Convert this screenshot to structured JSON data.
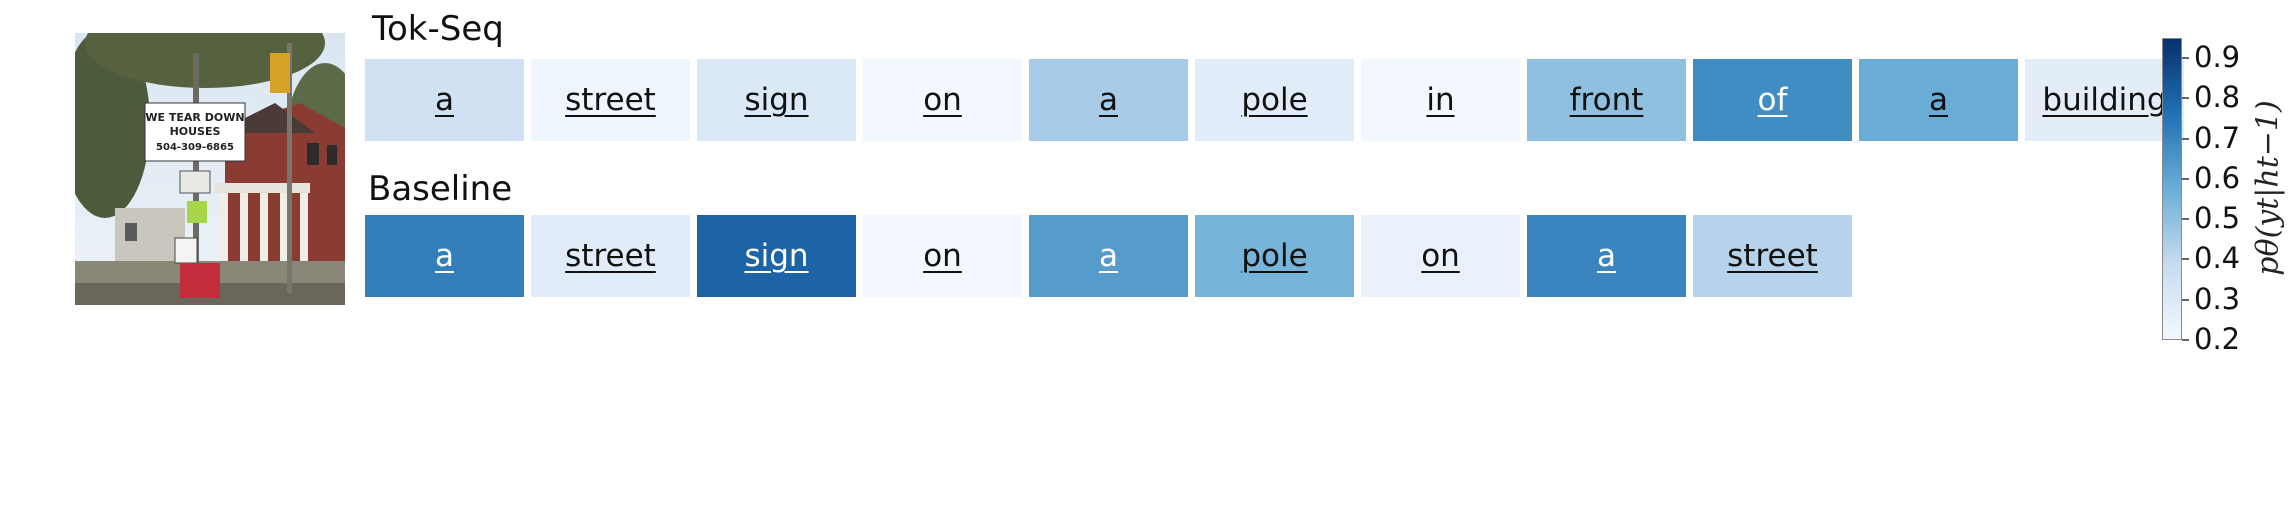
{
  "chart_data": {
    "type": "heatmap",
    "rows": [
      {
        "name": "Tok-Seq",
        "tokens": [
          {
            "text": "a",
            "value": 0.35
          },
          {
            "text": "street",
            "value": 0.22
          },
          {
            "text": "sign",
            "value": 0.3
          },
          {
            "text": "on",
            "value": 0.2
          },
          {
            "text": "a",
            "value": 0.45
          },
          {
            "text": "pole",
            "value": 0.28
          },
          {
            "text": "in",
            "value": 0.2
          },
          {
            "text": "front",
            "value": 0.5
          },
          {
            "text": "of",
            "value": 0.68
          },
          {
            "text": "a",
            "value": 0.58
          },
          {
            "text": "building",
            "value": 0.27
          }
        ]
      },
      {
        "name": "Baseline",
        "tokens": [
          {
            "text": "a",
            "value": 0.72
          },
          {
            "text": "street",
            "value": 0.28
          },
          {
            "text": "sign",
            "value": 0.8
          },
          {
            "text": "on",
            "value": 0.2
          },
          {
            "text": "a",
            "value": 0.63
          },
          {
            "text": "pole",
            "value": 0.55
          },
          {
            "text": "on",
            "value": 0.24
          },
          {
            "text": "a",
            "value": 0.7
          },
          {
            "text": "street",
            "value": 0.42
          }
        ]
      }
    ],
    "colorbar": {
      "label": "pθ(yt|ht−1)",
      "range": [
        0.2,
        0.95
      ],
      "ticks": [
        "0.9",
        "0.8",
        "0.7",
        "0.6",
        "0.5",
        "0.4",
        "0.3",
        "0.2"
      ],
      "colormap": "Blues"
    }
  },
  "image": {
    "sign_text": [
      "WE TEAR DOWN",
      "HOUSES",
      "504-309-6865"
    ]
  }
}
